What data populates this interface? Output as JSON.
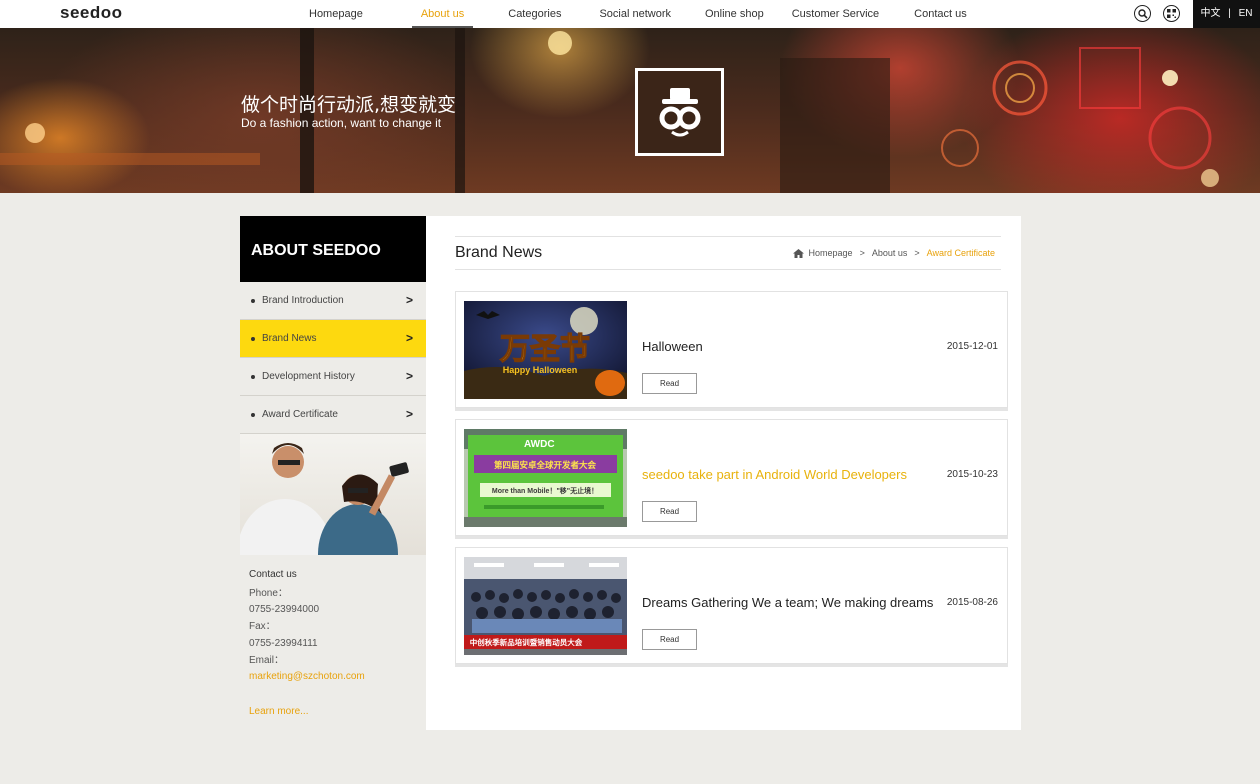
{
  "brand": {
    "logo_text": "seedoo"
  },
  "nav": {
    "items": [
      {
        "label": "Homepage"
      },
      {
        "label": "About us"
      },
      {
        "label": "Categories"
      },
      {
        "label": "Social network"
      },
      {
        "label": "Online shop"
      },
      {
        "label": "Customer Service"
      },
      {
        "label": "Contact us"
      }
    ],
    "active": "About us"
  },
  "lang": {
    "cn": "中文",
    "sep": "|",
    "en": "EN"
  },
  "banner": {
    "slogan_cn": "做个时尚行动派,想变就变",
    "slogan_en": "Do a fashion action, want to change it",
    "emblem_text": "oo"
  },
  "sidebar": {
    "heading": "ABOUT SEEDOO",
    "items": [
      {
        "label": "Brand Introduction"
      },
      {
        "label": "Brand News"
      },
      {
        "label": "Development History"
      },
      {
        "label": "Award Certificate"
      }
    ],
    "active": "Brand News",
    "arrow": ">"
  },
  "contact": {
    "title": "Contact us",
    "phone_label": "Phone：",
    "phone": "0755-23994000",
    "fax_label": "Fax：",
    "fax": "0755-23994111",
    "email_label": "Email：",
    "email": "marketing@szchoton.com",
    "learn_more": "Learn more..."
  },
  "main": {
    "title": "Brand News",
    "breadcrumb": {
      "home": "Homepage",
      "sep": ">",
      "section": "About us",
      "current": "Award Certificate"
    },
    "news": [
      {
        "title": "Halloween",
        "date": "2015-12-01",
        "read": "Read",
        "highlighted": false,
        "img_caption": "Happy Halloween",
        "img_text": "万圣节"
      },
      {
        "title": "seedoo take part in Android World Developers",
        "date": "2015-10-23",
        "read": "Read",
        "highlighted": true,
        "img_caption": "More than Mobile！\"移\"无止境！",
        "img_text": "第四届安卓全球开发者大会"
      },
      {
        "title": "Dreams Gathering We a team; We making dreams",
        "date": "2015-08-26",
        "read": "Read",
        "highlighted": false,
        "img_text": "中创秋季新品培训暨销售动员大会"
      }
    ]
  },
  "colors": {
    "accent": "#e8a20c",
    "sidebar_active": "#fdd90f",
    "page_bg": "#edece8"
  }
}
